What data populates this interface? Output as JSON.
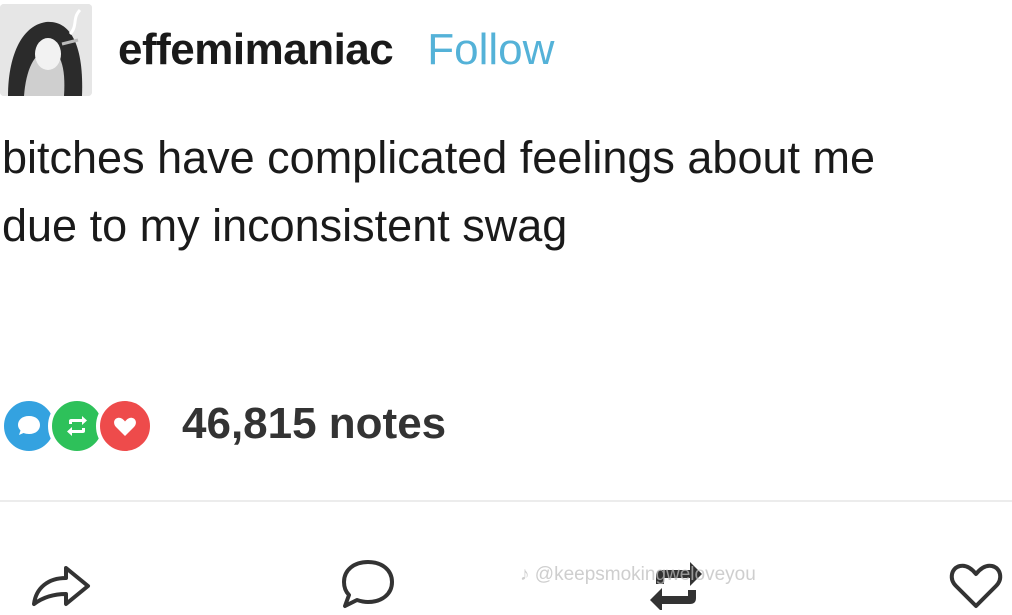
{
  "post": {
    "author": {
      "username": "effemimaniac",
      "follow_label": "Follow",
      "avatar_icon": "avatar-drawing"
    },
    "body_lines": [
      "bitches have complicated feelings about me",
      "due to my inconsistent swag"
    ],
    "notes": {
      "count_label": "46,815 notes",
      "icons": [
        "reply-note-icon",
        "reblog-note-icon",
        "like-note-icon"
      ],
      "colors": {
        "reply": "#34a2e0",
        "reblog": "#2ec15a",
        "like": "#ee4b4b"
      }
    },
    "actions": [
      "share-icon",
      "reply-icon",
      "reblog-icon",
      "like-icon"
    ]
  },
  "overlay": {
    "watermark": "♪ @keepsmokingweloveyou"
  },
  "colors": {
    "follow": "#54b2d8",
    "text": "#1a1a1a"
  }
}
